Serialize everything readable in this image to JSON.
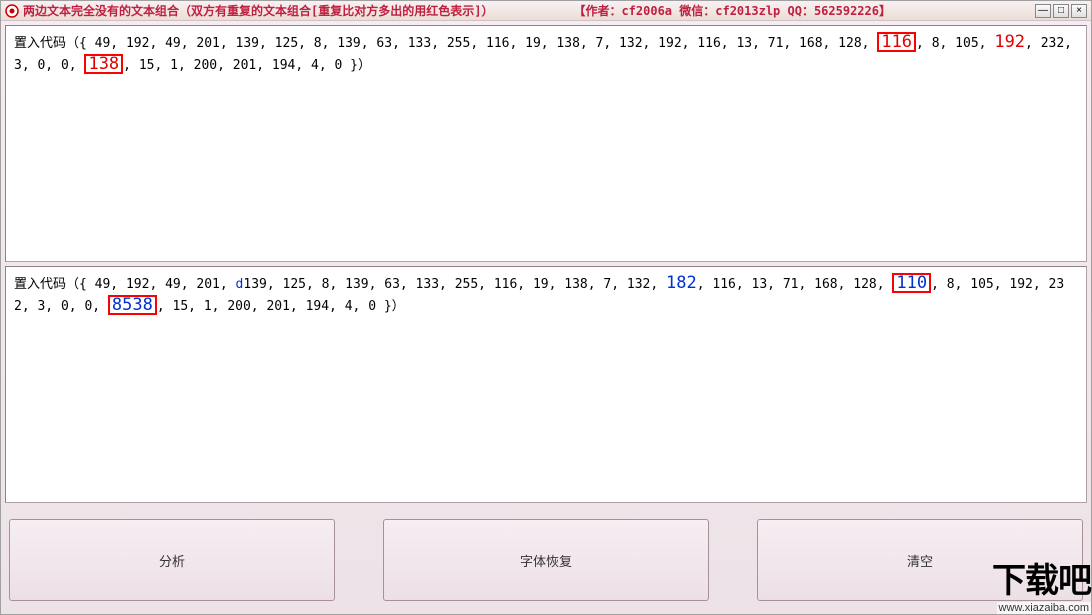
{
  "titlebar": {
    "title": "两边文本完全没有的文本组合（双方有重复的文本组合[重复比对方多出的用红色表示]）",
    "author": "【作者：cf2006a  微信：cf2013zlp  QQ：562592226】",
    "min": "—",
    "max": "□",
    "close": "×"
  },
  "panes": {
    "top": {
      "prefix": "置入代码（{ 49, 192, 49, 201, 139, 125, 8, 139, 63, 133, 255, 116, 19, 138, 7, 132, 192, 116, 13, 71, 168, 128, ",
      "b1": "116",
      "mid1": ", 8, 105, ",
      "r1": "192",
      "mid2": ", 232, 3, 0, 0, ",
      "b2": "138",
      "suffix": ", 15, 1, 200, 201, 194, 4, 0 }）"
    },
    "bottom": {
      "prefix": "置入代码（{ 49, 192, 49, 201, ",
      "d": "d",
      "mid0": "139, 125, 8, 139, 63, 133, 255, 116, 19, 138, 7, 132, ",
      "blue1": "182",
      "mid1": ", 116, 13, 71, 168, 128, ",
      "b1": "110",
      "mid2": ", 8, 105, 192, 232, 3, 0, 0, ",
      "b2": "8538",
      "suffix": ", 15, 1, 200, 201, 194, 4, 0 }）"
    }
  },
  "buttons": {
    "analyze": "分析",
    "restore": "字体恢复",
    "clear": "清空"
  },
  "watermark": {
    "big": "下载吧",
    "url": "www.xiazaiba.com"
  }
}
